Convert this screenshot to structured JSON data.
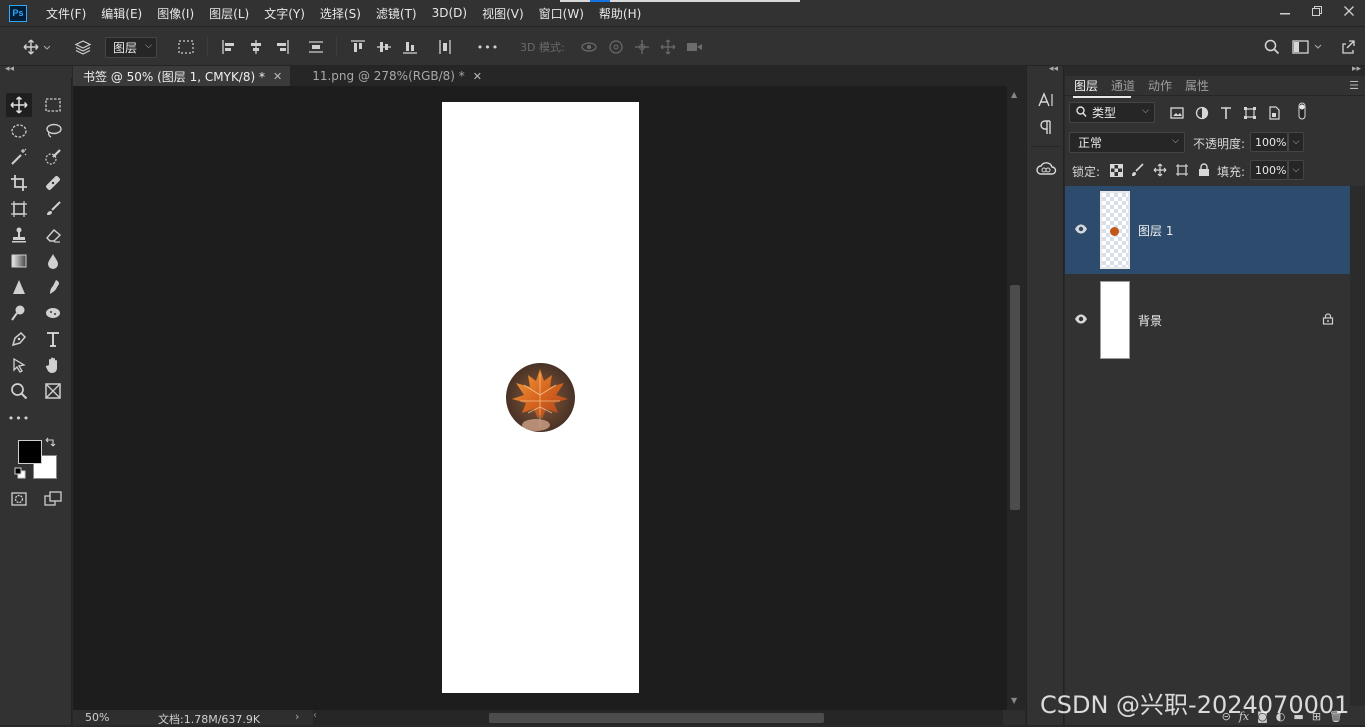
{
  "app": {
    "logo_text": "Ps"
  },
  "menu": [
    "文件(F)",
    "编辑(E)",
    "图像(I)",
    "图层(L)",
    "文字(Y)",
    "选择(S)",
    "滤镜(T)",
    "3D(D)",
    "视图(V)",
    "窗口(W)",
    "帮助(H)"
  ],
  "window_controls": [
    "minimize-icon",
    "restore-icon",
    "close-icon"
  ],
  "options_bar": {
    "auto_select_value": "图层",
    "mode_3d_label": "3D 模式:",
    "more_label": "•••"
  },
  "document_tabs": [
    {
      "label": "书签 @ 50% (图层 1, CMYK/8) *",
      "active": true
    },
    {
      "label": "11.png @ 278%(RGB/8) *",
      "active": false
    }
  ],
  "colors": {
    "foreground": "#000000",
    "background": "#ffffff",
    "selected_layer_bg": "#2d4b6c",
    "ui_dark": "#323232",
    "canvas_bg": "#1d1d1d"
  },
  "statusbar": {
    "zoom": "50%",
    "doc_info": "文档:1.78M/637.9K",
    "arrow": "›"
  },
  "layers_panel": {
    "tabs": [
      "图层",
      "通道",
      "动作",
      "属性"
    ],
    "active_tab": "图层",
    "filter_kind": "类型",
    "blend_mode": "正常",
    "opacity_label": "不透明度:",
    "opacity_value": "100%",
    "lock_label": "锁定:",
    "fill_label": "填充:",
    "fill_value": "100%",
    "layers": [
      {
        "name": "图层 1",
        "visible": true,
        "selected": true,
        "locked": false
      },
      {
        "name": "背景",
        "visible": true,
        "selected": false,
        "locked": true
      }
    ]
  },
  "watermark": "CSDN @兴职-2024070001"
}
